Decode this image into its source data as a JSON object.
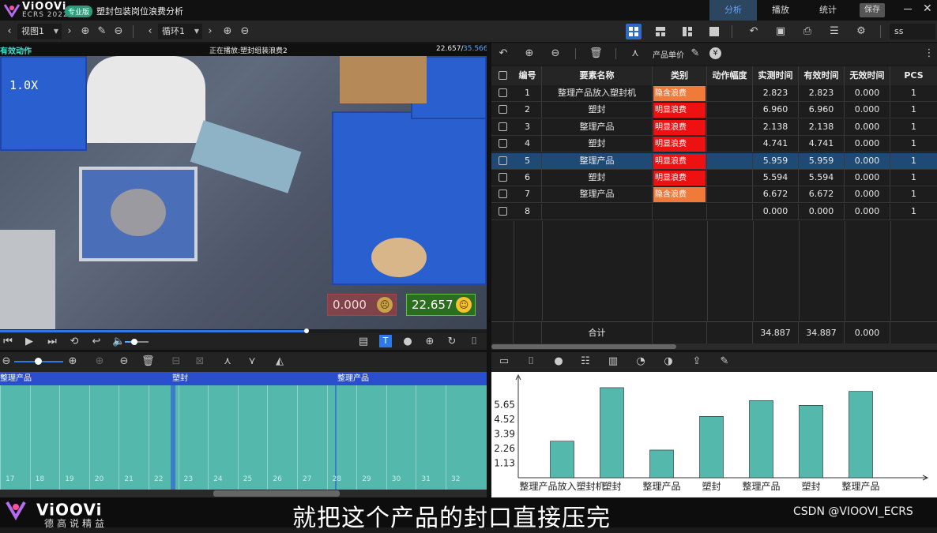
{
  "app": {
    "brand": "ViOOVi",
    "brand_sub": "ECRS 2022",
    "edition_badge": "专业版",
    "document_title": "塑封包装岗位浪费分析",
    "tabs": [
      {
        "label": "分析",
        "active": true
      },
      {
        "label": "播放",
        "active": false
      },
      {
        "label": "统计",
        "active": false
      }
    ],
    "save_label": "保存"
  },
  "toolbar": {
    "view_select": "视图1",
    "loop_select": "循环1",
    "search_value": "ss"
  },
  "video": {
    "header_left": "有效动作",
    "header_center": "正在播放:塑封组装浪费2",
    "time_current": "22.657/",
    "time_total": "35.566",
    "speed_label": "1.0X",
    "counter_invalid": "0.000",
    "counter_valid": "22.657",
    "progress_fraction": 0.63
  },
  "timeline": {
    "segments": [
      {
        "label": "整理产品"
      },
      {
        "label": "塑封"
      },
      {
        "label": "整理产品"
      }
    ],
    "ticks": [
      "17",
      "18",
      "19",
      "20",
      "21",
      "22",
      "23",
      "24",
      "25",
      "26",
      "27",
      "28",
      "29",
      "30",
      "31",
      "32"
    ]
  },
  "table": {
    "toolbar_label": "产品单价",
    "headers": [
      "编号",
      "要素名称",
      "类别",
      "动作幅度",
      "实测时间",
      "有效时间",
      "无效时间",
      "PCS"
    ],
    "rows": [
      {
        "id": "1",
        "name": "整理产品放入塑封机",
        "category": "隐含浪费",
        "cat_color": "#f07a3a",
        "measured": "2.823",
        "valid": "2.823",
        "invalid": "0.000",
        "pcs": "1",
        "selected": false
      },
      {
        "id": "2",
        "name": "塑封",
        "category": "明显浪费",
        "cat_color": "#ee1111",
        "measured": "6.960",
        "valid": "6.960",
        "invalid": "0.000",
        "pcs": "1",
        "selected": false
      },
      {
        "id": "3",
        "name": "整理产品",
        "category": "明显浪费",
        "cat_color": "#ee1111",
        "measured": "2.138",
        "valid": "2.138",
        "invalid": "0.000",
        "pcs": "1",
        "selected": false
      },
      {
        "id": "4",
        "name": "塑封",
        "category": "明显浪费",
        "cat_color": "#ee1111",
        "measured": "4.741",
        "valid": "4.741",
        "invalid": "0.000",
        "pcs": "1",
        "selected": false
      },
      {
        "id": "5",
        "name": "整理产品",
        "category": "明显浪费",
        "cat_color": "#ee1111",
        "measured": "5.959",
        "valid": "5.959",
        "invalid": "0.000",
        "pcs": "1",
        "selected": true
      },
      {
        "id": "6",
        "name": "塑封",
        "category": "明显浪费",
        "cat_color": "#ee1111",
        "measured": "5.594",
        "valid": "5.594",
        "invalid": "0.000",
        "pcs": "1",
        "selected": false
      },
      {
        "id": "7",
        "name": "整理产品",
        "category": "隐含浪费",
        "cat_color": "#f07a3a",
        "measured": "6.672",
        "valid": "6.672",
        "invalid": "0.000",
        "pcs": "1",
        "selected": false
      },
      {
        "id": "8",
        "name": "",
        "category": "",
        "cat_color": "",
        "measured": "0.000",
        "valid": "0.000",
        "invalid": "0.000",
        "pcs": "1",
        "selected": false
      }
    ],
    "total": {
      "label": "合计",
      "measured": "34.887",
      "valid": "34.887",
      "invalid": "0.000"
    }
  },
  "chart_data": {
    "type": "bar",
    "categories": [
      "整理产品放入塑封机",
      "塑封",
      "整理产品",
      "塑封",
      "整理产品",
      "塑封",
      "整理产品"
    ],
    "values": [
      2.823,
      6.96,
      2.138,
      4.741,
      5.959,
      5.594,
      6.672
    ],
    "yticks": [
      "1.13",
      "2.26",
      "3.39",
      "4.52",
      "5.65"
    ],
    "ylim": [
      0,
      7.2
    ],
    "bar_color": "#55b8ad",
    "title": "",
    "xlabel": "",
    "ylabel": "",
    "grid": false
  },
  "footer": {
    "brand": "ViOOVi",
    "brand_sub": "德高说精益",
    "subtitle": "就把这个产品的封口直接压完",
    "watermark": "CSDN @VIOOVI_ECRS"
  }
}
